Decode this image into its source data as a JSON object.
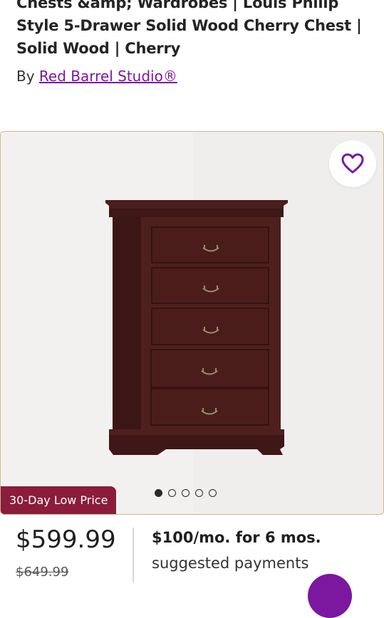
{
  "product": {
    "title": "Chests &amp; Wardrobes | Louis Philip Style 5-Drawer Solid Wood Cherry Chest | Solid Wood | Cherry",
    "by_label": "By",
    "brand": "Red Barrel Studio®"
  },
  "gallery": {
    "badge": "30-Day Low Price",
    "image_count": 5,
    "active_index": 0,
    "favorite_icon": "heart-outline-icon"
  },
  "pricing": {
    "price": "$599.99",
    "original_price": "$649.99",
    "finance_bold": "$100/mo. for 6 mos.",
    "finance_text": "suggested payments"
  },
  "colors": {
    "brand_purple": "#7b189f",
    "badge_red": "#8b1c3a",
    "wood": "#4a1e1c"
  }
}
